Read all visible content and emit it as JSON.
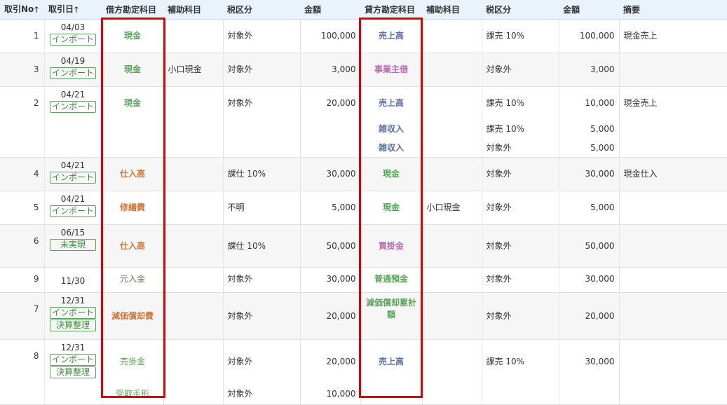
{
  "colors": {
    "header_bg": "#eaf3fb",
    "highlight_border": "#e00000",
    "badge_green": "#3d8c3d",
    "account_colors": {
      "cash": "#5aa35a",
      "sales": "#5b6fa8",
      "owner": "#b86bb0",
      "expense": "#d2773a",
      "neutral": "#7a6a5a"
    }
  },
  "headers": {
    "no": "取引No",
    "date": "取引日",
    "debit_account": "借方勘定科目",
    "debit_sub": "補助科目",
    "debit_tax": "税区分",
    "debit_amount": "金額",
    "credit_account": "貸方勘定科目",
    "credit_sub": "補助科目",
    "credit_tax": "税区分",
    "credit_amount": "金額",
    "memo": "摘要",
    "sort_icon": "🡑"
  },
  "rows": [
    {
      "no": "1",
      "date": "04/03",
      "tags": [
        "インポート"
      ],
      "debit": [
        {
          "account": "現金",
          "color": "#5aa35a",
          "sub": "",
          "tax": "対象外",
          "amount": "100,000"
        }
      ],
      "credit": [
        {
          "account": "売上高",
          "color": "#5b6fa8",
          "sub": "",
          "tax": "課売 10%",
          "amount": "100,000"
        }
      ],
      "memo": "現金売上"
    },
    {
      "no": "3",
      "date": "04/19",
      "tags": [
        "インポート"
      ],
      "debit": [
        {
          "account": "現金",
          "color": "#5aa35a",
          "sub": "小口現金",
          "tax": "対象外",
          "amount": "3,000"
        }
      ],
      "credit": [
        {
          "account": "事業主借",
          "color": "#b86bb0",
          "sub": "",
          "tax": "対象外",
          "amount": "3,000"
        }
      ],
      "memo": ""
    },
    {
      "no": "2",
      "date": "04/21",
      "tags": [
        "インポート"
      ],
      "debit": [
        {
          "account": "現金",
          "color": "#5aa35a",
          "sub": "",
          "tax": "対象外",
          "amount": "20,000"
        }
      ],
      "credit": [
        {
          "account": "売上高",
          "color": "#5b6fa8",
          "sub": "",
          "tax": "課売 10%",
          "amount": "10,000"
        },
        {
          "account": "雑収入",
          "color": "#5b6fa8",
          "sub": "",
          "tax": "課売 10%",
          "amount": "5,000"
        },
        {
          "account": "雑収入",
          "color": "#5b6fa8",
          "sub": "",
          "tax": "対象外",
          "amount": "5,000"
        }
      ],
      "memo": "現金売上"
    },
    {
      "no": "4",
      "date": "04/21",
      "tags": [
        "インポート"
      ],
      "debit": [
        {
          "account": "仕入高",
          "color": "#d2773a",
          "sub": "",
          "tax": "課仕 10%",
          "amount": "30,000"
        }
      ],
      "credit": [
        {
          "account": "現金",
          "color": "#5aa35a",
          "sub": "",
          "tax": "対象外",
          "amount": "30,000"
        }
      ],
      "memo": "現金仕入"
    },
    {
      "no": "5",
      "date": "04/21",
      "tags": [
        "インポート"
      ],
      "debit": [
        {
          "account": "修繕費",
          "color": "#d2773a",
          "sub": "",
          "tax": "不明",
          "amount": "5,000"
        }
      ],
      "credit": [
        {
          "account": "現金",
          "color": "#5aa35a",
          "sub": "小口現金",
          "tax": "対象外",
          "amount": "5,000"
        }
      ],
      "memo": ""
    },
    {
      "no": "6",
      "date": "06/15",
      "tags": [
        "未実現"
      ],
      "debit": [
        {
          "account": "仕入高",
          "color": "#d2773a",
          "sub": "",
          "tax": "課仕 10%",
          "amount": "50,000"
        }
      ],
      "credit": [
        {
          "account": "買掛金",
          "color": "#b86bb0",
          "sub": "",
          "tax": "対象外",
          "amount": "50,000"
        }
      ],
      "memo": ""
    },
    {
      "no": "9",
      "date": "11/30",
      "tags": [],
      "debit": [
        {
          "account": "元入金",
          "color": "#7a6a5a",
          "sub": "",
          "tax": "対象外",
          "amount": "30,000"
        }
      ],
      "credit": [
        {
          "account": "普通預金",
          "color": "#5aa35a",
          "sub": "",
          "tax": "対象外",
          "amount": "30,000"
        }
      ],
      "memo": ""
    },
    {
      "no": "7",
      "date": "12/31",
      "tags": [
        "インポート",
        "決算整理"
      ],
      "debit": [
        {
          "account": "減価償却費",
          "color": "#d2773a",
          "sub": "",
          "tax": "対象外",
          "amount": "20,000"
        }
      ],
      "credit": [
        {
          "account": "減価償却累計額",
          "color": "#5aa35a",
          "sub": "",
          "tax": "対象外",
          "amount": "20,000"
        }
      ],
      "memo": ""
    },
    {
      "no": "8",
      "date": "12/31",
      "tags": [
        "インポート",
        "決算整理"
      ],
      "debit": [
        {
          "account": "売掛金",
          "color": "#5aa35a",
          "sub": "",
          "tax": "対象外",
          "amount": "20,000"
        },
        {
          "account": "受取手形",
          "color": "#5aa35a",
          "sub": "",
          "tax": "対象外",
          "amount": "10,000"
        }
      ],
      "credit": [
        {
          "account": "売上高",
          "color": "#5b6fa8",
          "sub": "",
          "tax": "課売 10%",
          "amount": "30,000"
        }
      ],
      "memo": ""
    }
  ]
}
